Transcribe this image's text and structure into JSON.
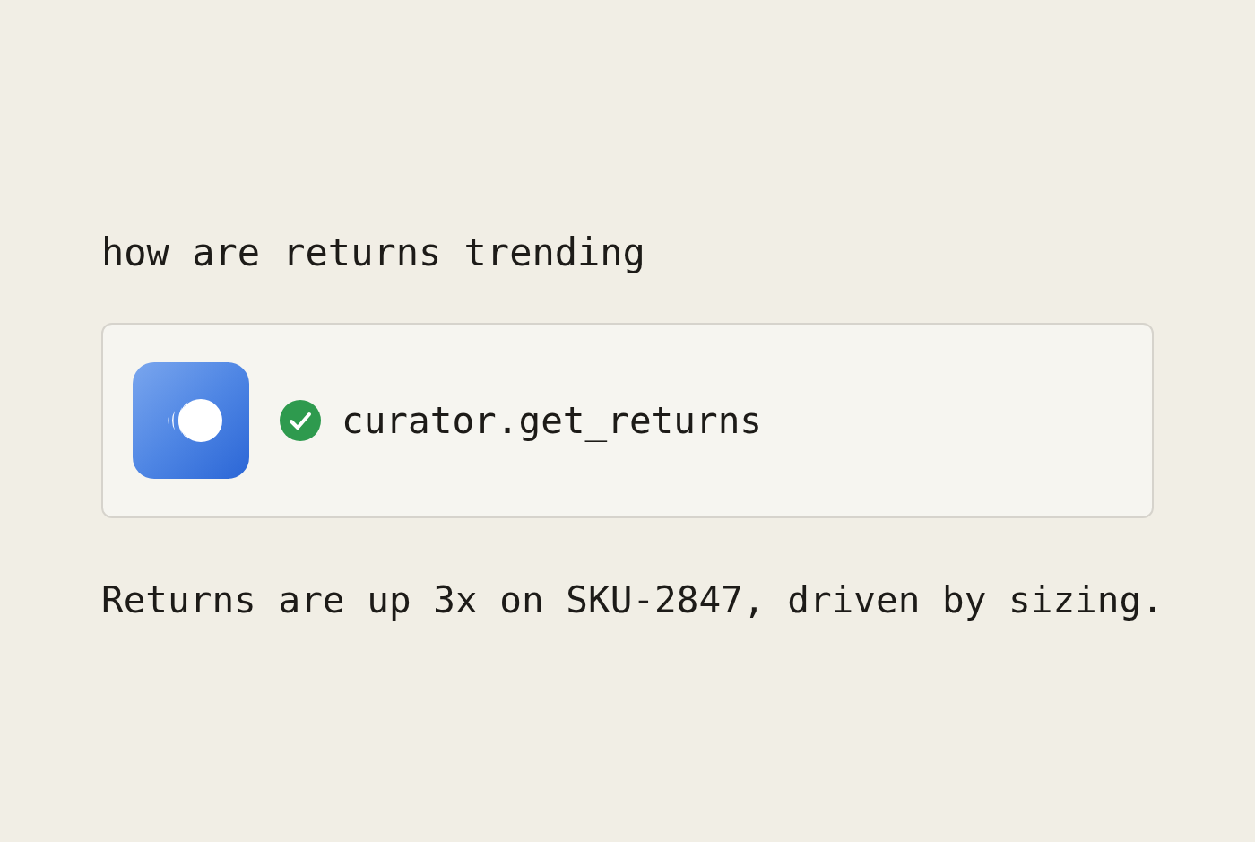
{
  "prompt": "how are returns trending",
  "tool_call": {
    "name": "curator.get_returns",
    "completed": true
  },
  "answer": "Returns are up 3x on SKU-2847, driven by sizing."
}
